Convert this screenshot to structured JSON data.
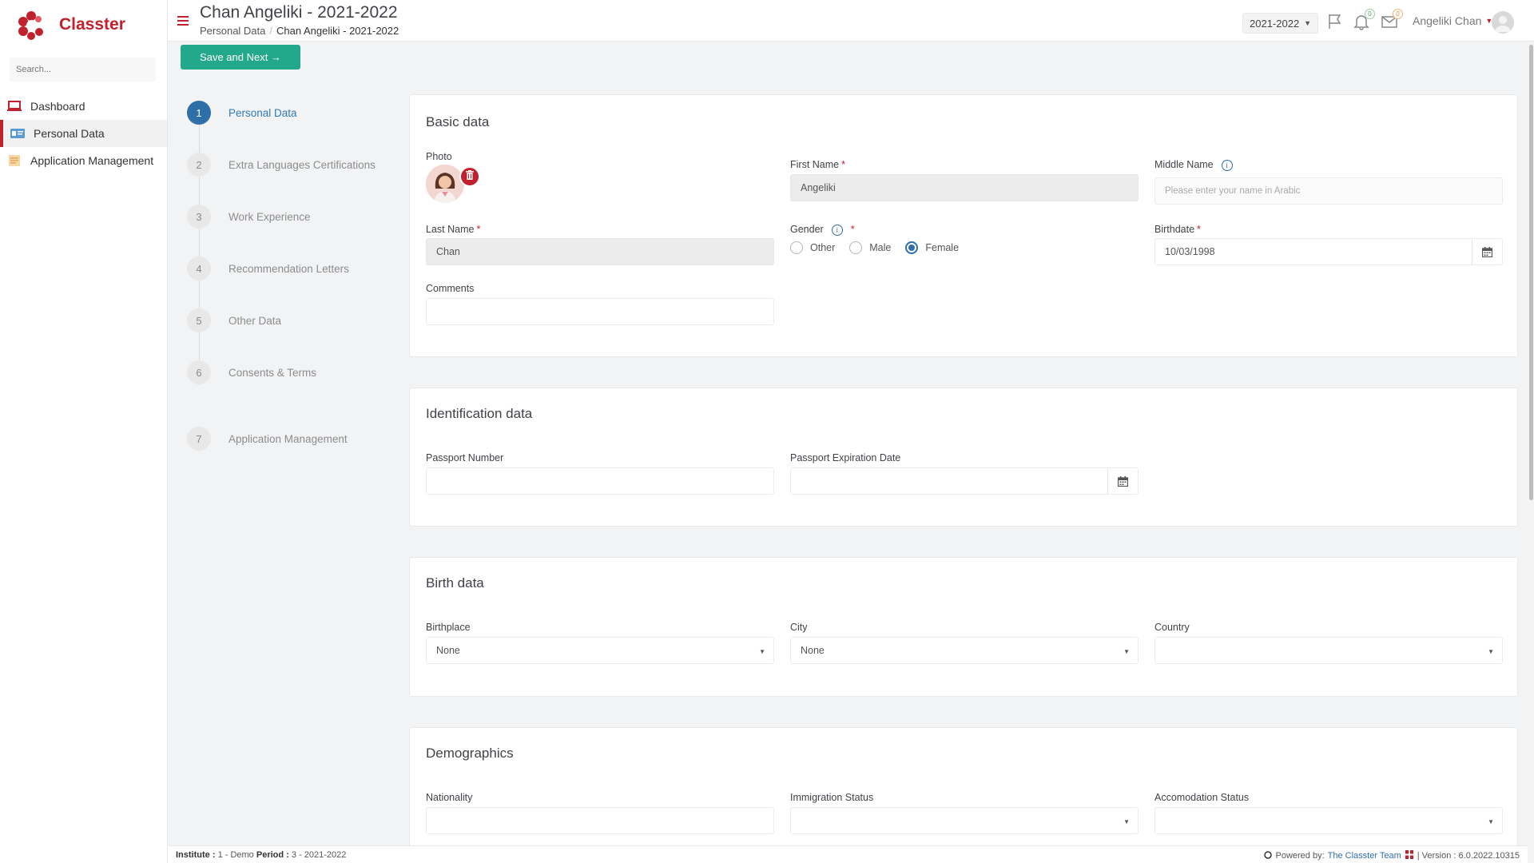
{
  "brand": {
    "name": "Classter"
  },
  "sidebar": {
    "search_placeholder": "Search...",
    "items": [
      {
        "label": "Dashboard",
        "icon": "laptop-icon"
      },
      {
        "label": "Personal Data",
        "icon": "id-card-icon"
      },
      {
        "label": "Application Management",
        "icon": "document-icon"
      }
    ]
  },
  "header": {
    "title": "Chan Angeliki - 2021-2022",
    "breadcrumb": [
      "Personal Data",
      "Chan Angeliki - 2021-2022"
    ],
    "period": "2021-2022",
    "notifications_count": "0",
    "messages_count": "0",
    "user_name": "Angeliki Chan"
  },
  "actions": {
    "save_next": "Save and Next →"
  },
  "steps": [
    {
      "num": "1",
      "label": "Personal Data"
    },
    {
      "num": "2",
      "label": "Extra Languages Certifications"
    },
    {
      "num": "3",
      "label": "Work Experience"
    },
    {
      "num": "4",
      "label": "Recommendation Letters"
    },
    {
      "num": "5",
      "label": "Other Data"
    },
    {
      "num": "6",
      "label": "Consents & Terms"
    },
    {
      "num": "7",
      "label": "Application Management"
    }
  ],
  "basic": {
    "title": "Basic data",
    "photo_label": "Photo",
    "first_name_label": "First Name",
    "first_name_value": "Angeliki",
    "middle_name_label": "Middle Name",
    "middle_name_placeholder": "Please enter your name in Arabic",
    "last_name_label": "Last Name",
    "last_name_value": "Chan",
    "gender_label": "Gender",
    "gender_options": [
      "Other",
      "Male",
      "Female"
    ],
    "gender_selected": "Female",
    "birthdate_label": "Birthdate",
    "birthdate_value": "10/03/1998",
    "comments_label": "Comments",
    "comments_value": ""
  },
  "identification": {
    "title": "Identification data",
    "passport_number_label": "Passport Number",
    "passport_number_value": "",
    "passport_expiration_label": "Passport Expiration Date",
    "passport_expiration_value": ""
  },
  "birth": {
    "title": "Birth data",
    "birthplace_label": "Birthplace",
    "birthplace_value": "None",
    "city_label": "City",
    "city_value": "None",
    "country_label": "Country",
    "country_value": ""
  },
  "demographics": {
    "title": "Demographics",
    "nationality_label": "Nationality",
    "nationality_value": "",
    "immigration_label": "Immigration Status",
    "immigration_value": "",
    "accomodation_label": "Accomodation Status",
    "accomodation_value": ""
  },
  "footer": {
    "institute_label": "Institute :",
    "institute_value": "1 - Demo",
    "period_label": "Period :",
    "period_value": "3 - 2021-2022",
    "powered_by": "Powered by:",
    "team_link": "The Classter Team",
    "version": "| Version : 6.0.2022.10315"
  },
  "colors": {
    "brand_red": "#c0212d",
    "primary_green": "#22a98b",
    "active_blue": "#2f6fa8"
  }
}
